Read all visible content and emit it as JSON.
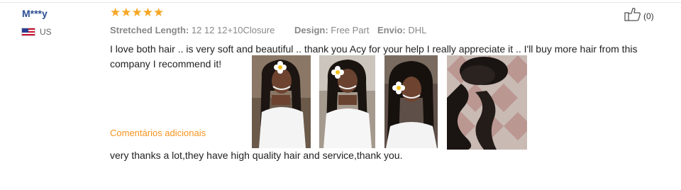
{
  "review": {
    "user_name": "M***y",
    "country": "US",
    "flag_icon": "us-flag-icon",
    "rating": 5,
    "stars": [
      "★",
      "★",
      "★",
      "★",
      "★"
    ],
    "attributes": [
      {
        "key": "Stretched Length:",
        "value": "12 12 12+10Closure"
      },
      {
        "key": "Design:",
        "value": "Free Part"
      },
      {
        "key": "Envio:",
        "value": "DHL"
      }
    ],
    "text": "I love both hair .. is very soft and beautiful .. thank you  Acy  for your help I really appreciate it .. I'll buy more hair from this company I recommend it!",
    "additional_label": "Comentários adicionais",
    "additional_text": "very thanks a lot,they have high quality hair and service,thank you.",
    "helpful_icon": "thumbs-up-icon",
    "helpful_count": "(0)",
    "photos": [
      {
        "icon": "review-photo-1"
      },
      {
        "icon": "review-photo-2"
      },
      {
        "icon": "review-photo-3"
      },
      {
        "icon": "review-photo-4"
      }
    ]
  },
  "colors": {
    "star": "#f5a623",
    "user_name": "#2d4f92",
    "additional_label": "#f7941d",
    "attribute": "#888888"
  }
}
